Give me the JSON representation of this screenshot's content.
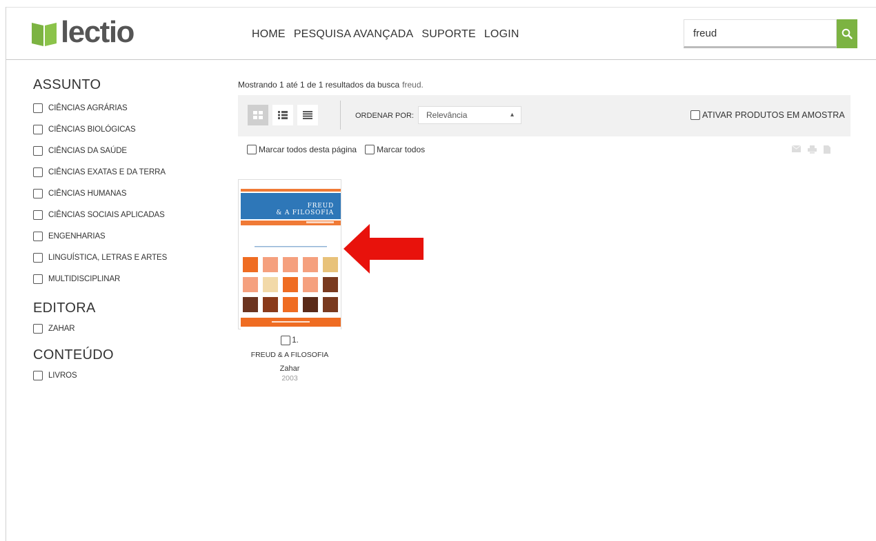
{
  "header": {
    "logo_text": "lectio",
    "nav": [
      "HOME",
      "PESQUISA AVANÇADA",
      "SUPORTE",
      "LOGIN"
    ],
    "search_value": "freud",
    "accent_color": "#7cb342"
  },
  "sidebar": {
    "sections": [
      {
        "title": "ASSUNTO",
        "items": [
          "CIÊNCIAS AGRÁRIAS",
          "CIÊNCIAS BIOLÓGICAS",
          "CIÊNCIAS DA SAÚDE",
          "CIÊNCIAS EXATAS E DA TERRA",
          "CIÊNCIAS HUMANAS",
          "CIÊNCIAS SOCIAIS APLICADAS",
          "ENGENHARIAS",
          "LINGUÍSTICA, LETRAS E ARTES",
          "MULTIDISCIPLINAR"
        ]
      },
      {
        "title": "EDITORA",
        "items": [
          "ZAHAR"
        ]
      },
      {
        "title": "CONTEÚDO",
        "items": [
          "LIVROS"
        ]
      }
    ]
  },
  "results": {
    "summary": "Mostrando 1 até 1 de 1 resultados da busca",
    "query": "freud."
  },
  "toolbar": {
    "order_label": "ORDENAR POR:",
    "order_value": "Relevância",
    "sample_label": "ATIVAR PRODUTOS EM AMOSTRA"
  },
  "mark": {
    "page_label": "Marcar todos desta página",
    "all_label": "Marcar todos"
  },
  "icons": {
    "view": [
      "grid-view-icon",
      "list-view-icon",
      "compact-list-view-icon"
    ],
    "actions": [
      "email-icon",
      "print-icon",
      "export-icon"
    ],
    "search": "search-icon",
    "annotation": "red-arrow-icon"
  },
  "result_card": {
    "number": "1.",
    "title": "FREUD & A FILOSOFIA",
    "publisher": "Zahar",
    "year": "2003",
    "cover_title_line1": "FREUD",
    "cover_title_line2": "& A FILOSOFIA"
  }
}
